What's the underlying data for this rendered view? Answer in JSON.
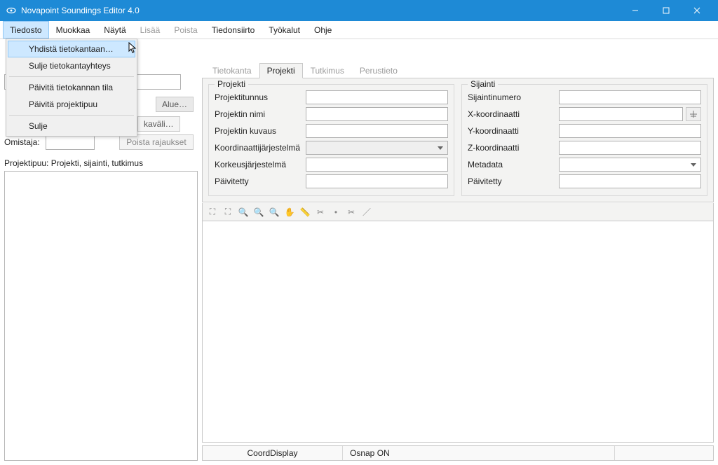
{
  "window": {
    "title": "Novapoint Soundings Editor 4.0"
  },
  "menubar": {
    "items": [
      {
        "label": "Tiedosto",
        "open": true
      },
      {
        "label": "Muokkaa"
      },
      {
        "label": "Näytä"
      },
      {
        "label": "Lisää",
        "disabled": true
      },
      {
        "label": "Poista",
        "disabled": true
      },
      {
        "label": "Tiedonsiirto"
      },
      {
        "label": "Työkalut"
      },
      {
        "label": "Ohje"
      }
    ]
  },
  "dropdown": {
    "items": [
      {
        "label": "Yhdistä tietokantaan…",
        "hover": true
      },
      {
        "label": "Sulje tietokantayhteys"
      },
      {
        "sep": true
      },
      {
        "label": "Päivitä tietokannan tila"
      },
      {
        "label": "Päivitä projektipuu"
      },
      {
        "sep": true
      },
      {
        "label": "Sulje"
      }
    ]
  },
  "left": {
    "alue": "Alue…",
    "kavali": "kaväli…",
    "omistaja_label": "Omistaja:",
    "poista": "Poista rajaukset",
    "tree_label": "Projektipuu: Projekti, sijainti, tutkimus"
  },
  "tabs": {
    "items": [
      "Tietokanta",
      "Projekti",
      "Tutkimus",
      "Perustieto"
    ],
    "active": 1
  },
  "projekti": {
    "legend": "Projekti",
    "rows": [
      {
        "label": "Projektitunnus",
        "type": "input"
      },
      {
        "label": "Projektin nimi",
        "type": "input"
      },
      {
        "label": "Projektin kuvaus",
        "type": "input"
      },
      {
        "label": "Koordinaattijärjestelmä",
        "type": "select_disabled"
      },
      {
        "label": "Korkeusjärjestelmä",
        "type": "input"
      },
      {
        "label": "Päivitetty",
        "type": "input"
      }
    ]
  },
  "sijainti": {
    "legend": "Sijainti",
    "rows": [
      {
        "label": "Sijaintinumero",
        "type": "input"
      },
      {
        "label": "X-koordinaatti",
        "type": "input_icon"
      },
      {
        "label": "Y-koordinaatti",
        "type": "input"
      },
      {
        "label": "Z-koordinaatti",
        "type": "input"
      },
      {
        "label": "Metadata",
        "type": "select"
      },
      {
        "label": "Päivitetty",
        "type": "input"
      }
    ]
  },
  "toolbar_icons": [
    "zoom-extents",
    "zoom-window",
    "zoom-in",
    "zoom-out",
    "zoom-realtime",
    "pan",
    "measure",
    "clip",
    "point",
    "scissors",
    "line"
  ],
  "statusbar": {
    "coord": "CoordDisplay",
    "osnap": "Osnap ON"
  }
}
